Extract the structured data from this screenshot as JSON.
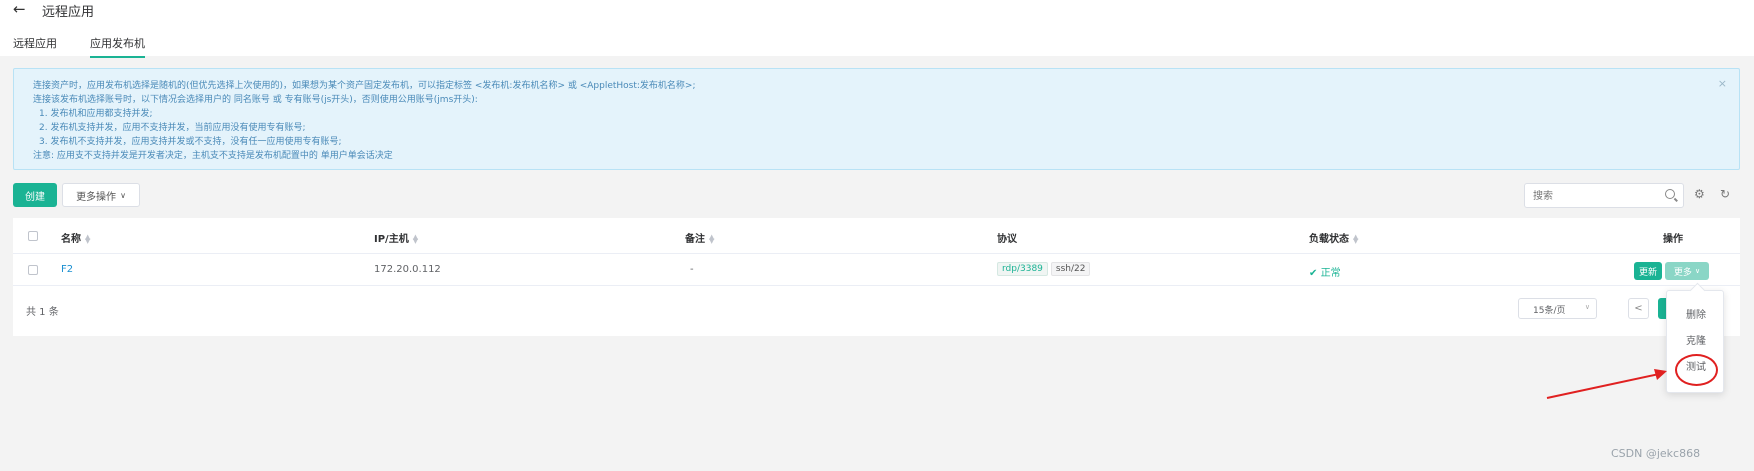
{
  "header": {
    "back_icon": "←",
    "title": "远程应用",
    "tabs": [
      {
        "label": "远程应用",
        "active": false
      },
      {
        "label": "应用发布机",
        "active": true
      }
    ]
  },
  "alert": {
    "lines": [
      "连接资产时，应用发布机选择是随机的(但优先选择上次使用的)，如果想为某个资产固定发布机，可以指定标签 <发布机:发布机名称> 或 <AppletHost:发布机名称>;",
      "连接该发布机选择账号时，以下情况会选择用户的 同名账号 或 专有账号(js开头)，否则使用公用账号(jms开头):",
      "1. 发布机和应用都支持并发;",
      "2. 发布机支持并发，应用不支持并发，当前应用没有使用专有账号;",
      "3. 发布机不支持并发，应用支持并发或不支持，没有任一应用使用专有账号;",
      "注意: 应用支不支持并发是开发者决定，主机支不支持是发布机配置中的 单用户单会话决定"
    ],
    "close": "×",
    "color": "#4a8ab8"
  },
  "toolbar": {
    "create_label": "创建",
    "more_actions_label": "更多操作",
    "search_placeholder": "搜索",
    "settings_icon": "⚙",
    "refresh_icon": "↻"
  },
  "table": {
    "headers": {
      "name": "名称",
      "ip": "IP/主机",
      "comment": "备注",
      "protocols": "协议",
      "load": "负载状态",
      "actions": "操作"
    },
    "rows": [
      {
        "name": "F2",
        "ip": "172.20.0.112",
        "comment": "-",
        "protocols": [
          "rdp/3389",
          "ssh/22"
        ],
        "status_icon": "✔",
        "status": "正常",
        "update_label": "更新",
        "more_label": "更多"
      }
    ]
  },
  "footer": {
    "total": "共 1 条",
    "page_size": "15条/页",
    "prev": "<"
  },
  "dropdown": {
    "items": [
      "删除",
      "克隆",
      "测试"
    ]
  },
  "watermark": "CSDN @jekc868",
  "colors": {
    "primary": "#1ab394",
    "annotation": "#e02020"
  }
}
